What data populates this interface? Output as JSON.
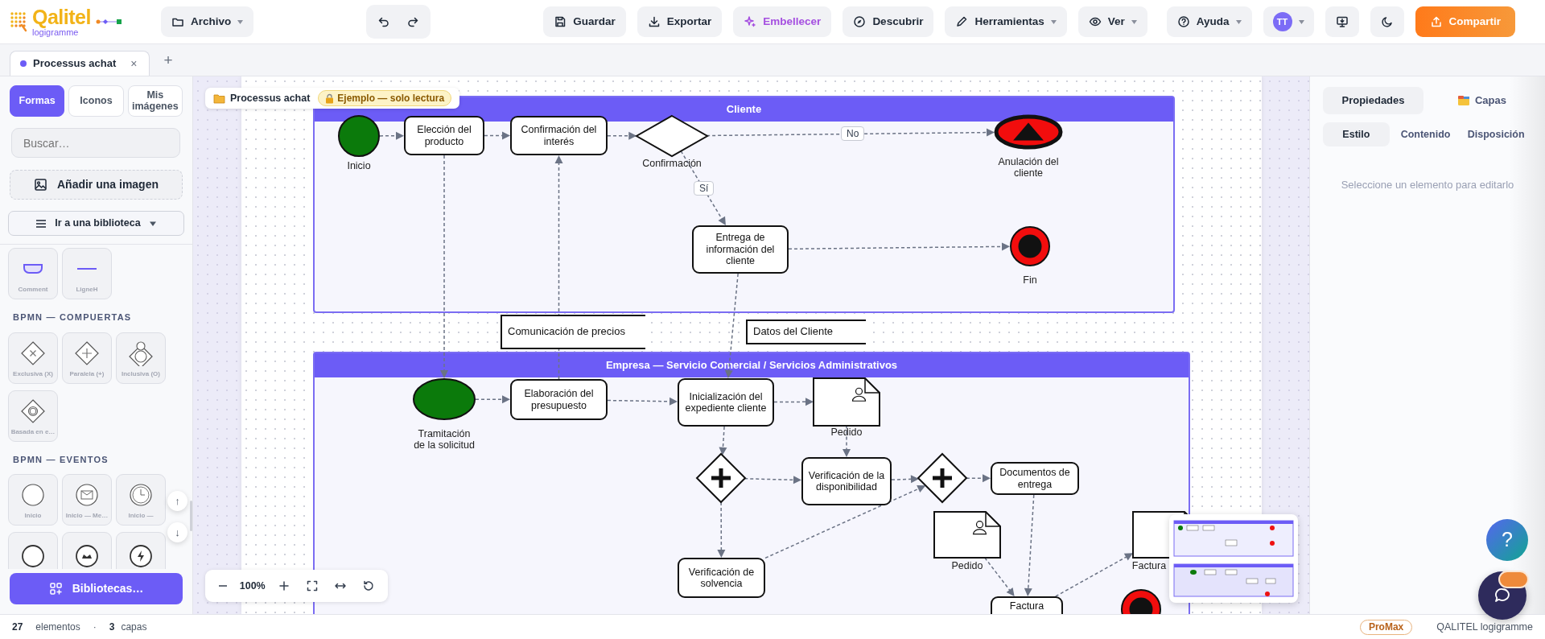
{
  "header": {
    "logo": {
      "name": "Qalitel",
      "subtitle": "logigramme"
    },
    "groups": [
      [
        {
          "kind": "plain",
          "label": "Archivo"
        }
      ],
      [
        {
          "kind": "icon"
        },
        {
          "kind": "icon"
        }
      ],
      [
        {
          "kind": "plain",
          "label": "Guardar"
        },
        {
          "kind": "plain",
          "label": "Exportar"
        },
        {
          "kind": "accent",
          "label": "Embellecer"
        },
        {
          "kind": "plain",
          "label": "Descubrir"
        },
        {
          "kind": "plain",
          "label": "Herramientas"
        },
        {
          "kind": "plain",
          "label": "Ver"
        }
      ],
      [
        {
          "kind": "plain",
          "label": "Ayuda"
        },
        {
          "kind": "avatar",
          "avatar": "TT"
        },
        {
          "kind": "plain"
        },
        {
          "kind": "plain"
        },
        {
          "kind": "primary",
          "label": "Compartir"
        }
      ]
    ]
  },
  "doc_tabs": {
    "tabs": [
      {
        "label": "Processus achat",
        "selected": true,
        "close": "×"
      }
    ],
    "new_tab": "+"
  },
  "library": {
    "tabs": [
      {
        "label": "Formas",
        "selected": true
      },
      {
        "label": "Iconos",
        "selected": false
      },
      {
        "label": "Mis imágenes",
        "selected": false
      }
    ],
    "search": {
      "placeholder": "Buscar…"
    },
    "add_image": "Añadir una imagen",
    "goto": "Ir a una biblioteca",
    "sections": [
      {
        "items": [
          {
            "kind": "tile",
            "label": "Comment"
          },
          {
            "kind": "tile",
            "label": "LigneH"
          }
        ]
      },
      {
        "title": "BPMN — COMPUERTAS",
        "items": [
          {
            "kind": "tile",
            "label": "Exclusiva (X)"
          },
          {
            "kind": "tile",
            "label": "Paralela (+)"
          },
          {
            "kind": "tile",
            "label": "Inclusiva (O)"
          },
          {
            "kind": "tile",
            "label": "Basada en e…"
          }
        ]
      },
      {
        "title": "BPMN — EVENTOS",
        "items": [
          {
            "kind": "tile",
            "label": "Inicio"
          },
          {
            "kind": "tile",
            "label": "Inicio — Me…"
          },
          {
            "kind": "tile",
            "label": "Inicio —"
          },
          {
            "kind": "tile"
          },
          {
            "kind": "tile"
          },
          {
            "kind": "tile"
          }
        ]
      }
    ],
    "scroll_up": "↑",
    "scroll_down": "↓",
    "libraries": "Bibliotecas…"
  },
  "canvas": {
    "title": "Processus achat",
    "badge": "Ejemplo — solo lectura",
    "pools": [
      {
        "name": "Cliente"
      },
      {
        "name": "Empresa — Servicio Comercial / Servicios Administrativos"
      }
    ],
    "nodes": [
      {
        "kind": "start",
        "label": "Inicio"
      },
      {
        "kind": "task",
        "label": "Elección del producto"
      },
      {
        "kind": "task",
        "label": "Confirmación del interés"
      },
      {
        "kind": "gateway_exclusive",
        "label": "Confirmación"
      },
      {
        "kind": "end_cancel",
        "label": "Anulación del cliente"
      },
      {
        "kind": "task",
        "label": "Entrega de información del cliente"
      },
      {
        "kind": "end_terminate",
        "label": "Fin"
      },
      {
        "kind": "annotation",
        "label": "Comunicación de precios"
      },
      {
        "kind": "annotation",
        "label": "Datos del Cliente"
      },
      {
        "kind": "start",
        "label": "Tramitación de la solicitud"
      },
      {
        "kind": "task",
        "label": "Elaboración del presupuesto"
      },
      {
        "kind": "task",
        "label": "Inicialización del expediente cliente"
      },
      {
        "kind": "document",
        "label": "Pedido"
      },
      {
        "kind": "gateway_parallel"
      },
      {
        "kind": "task",
        "label": "Verificación de la disponibilidad"
      },
      {
        "kind": "task",
        "label": "Verificación de solvencia"
      },
      {
        "kind": "gateway_parallel"
      },
      {
        "kind": "task",
        "label": "Documentos de entrega"
      },
      {
        "kind": "document",
        "label": "Pedido"
      },
      {
        "kind": "document",
        "label": "Factura"
      },
      {
        "kind": "task",
        "label": "Factura"
      },
      {
        "kind": "end_terminate"
      }
    ],
    "flow_labels": [
      "No",
      "Sí"
    ],
    "zoom": "100%"
  },
  "properties": {
    "tabs": [
      {
        "label": "Propiedades",
        "selected": true
      },
      {
        "label": "Capas",
        "selected": false
      }
    ],
    "subtabs": [
      {
        "label": "Estilo",
        "selected": true
      },
      {
        "label": "Contenido",
        "selected": false
      },
      {
        "label": "Disposición",
        "selected": false
      }
    ],
    "empty_message": "Seleccione un elemento para editarlo"
  },
  "help": "?",
  "status": {
    "elements_count": "27",
    "elements_label": "elementos",
    "separator": "·",
    "layers_count": "3",
    "layers_label": "capas",
    "plan": "ProMax",
    "app_name": "QALITEL logigramme"
  }
}
